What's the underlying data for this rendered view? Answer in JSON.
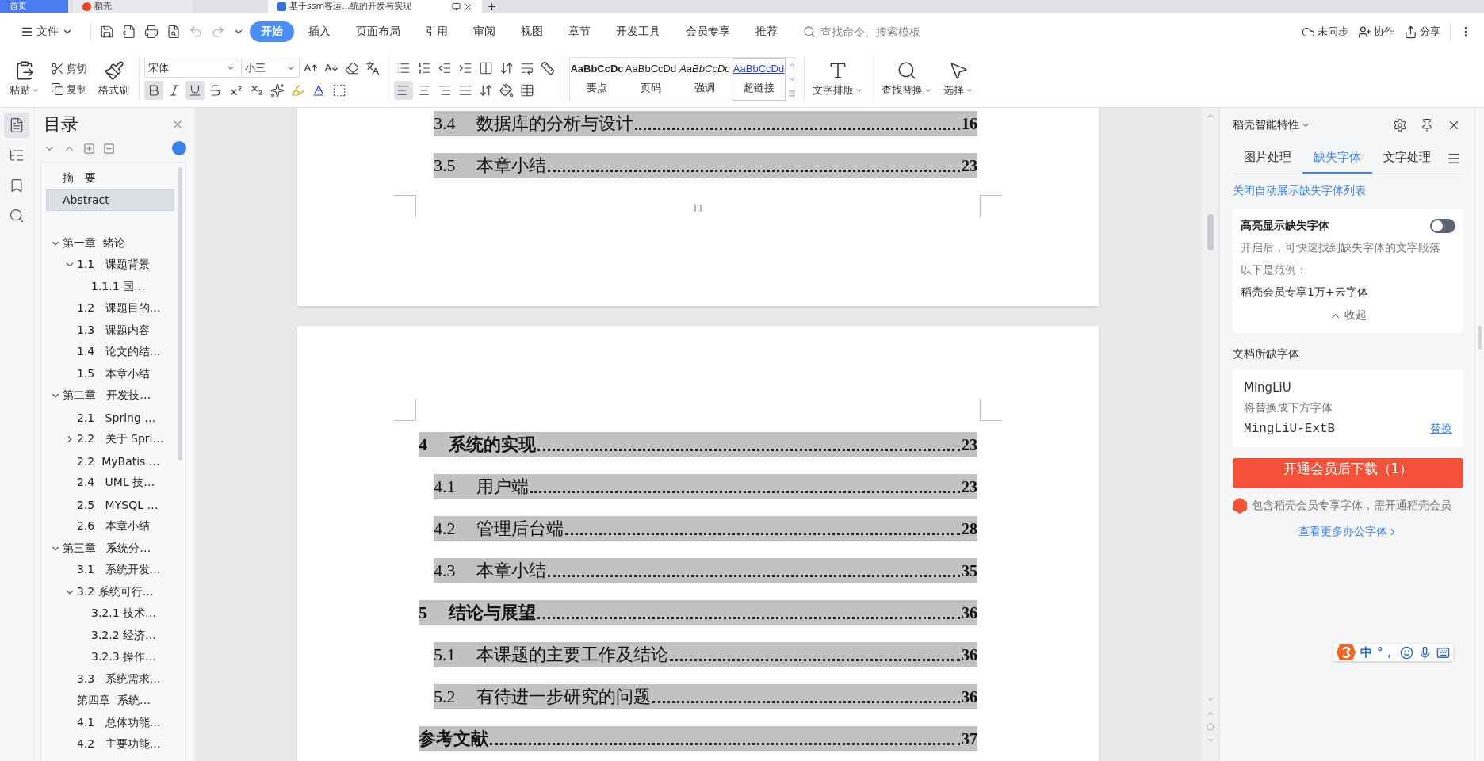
{
  "tabs": [
    {
      "label": "首页",
      "kind": "home",
      "selected": false
    },
    {
      "label": "稻壳",
      "kind": "docer",
      "selected": false
    },
    {
      "label": "基于ssm客运...统的开发与实现",
      "kind": "doc",
      "selected": true
    }
  ],
  "menu": {
    "file": "文件",
    "items": [
      {
        "label": "开始",
        "selected": true
      },
      {
        "label": "插入",
        "selected": false
      },
      {
        "label": "页面布局",
        "selected": false
      },
      {
        "label": "引用",
        "selected": false
      },
      {
        "label": "审阅",
        "selected": false
      },
      {
        "label": "视图",
        "selected": false
      },
      {
        "label": "章节",
        "selected": false
      },
      {
        "label": "开发工具",
        "selected": false
      },
      {
        "label": "会员专享",
        "selected": false
      },
      {
        "label": "推荐",
        "selected": false
      }
    ],
    "search": {
      "placeholder": "查找命令、搜索模板"
    },
    "actions": [
      {
        "kind": "sync",
        "label": "未同步"
      },
      {
        "kind": "collab",
        "label": "协作"
      },
      {
        "kind": "share",
        "label": "分享"
      }
    ]
  },
  "ribbon": {
    "paste": "粘贴",
    "cut": "剪切",
    "copy": "复制",
    "format_painter": "格式刷",
    "font": "宋体",
    "size": "小三",
    "format": [
      {
        "kind": "bold",
        "on": true
      },
      {
        "kind": "italic",
        "on": false
      },
      {
        "kind": "underline",
        "on": true
      }
    ],
    "align": [
      {
        "kind": "left",
        "on": true
      },
      {
        "kind": "center",
        "on": false
      },
      {
        "kind": "right",
        "on": false
      },
      {
        "kind": "justify",
        "on": false
      }
    ],
    "styles": [
      {
        "sample": "AaBbCcDc",
        "label": "要点",
        "kind": "bold",
        "selected": false
      },
      {
        "sample": "AaBbCcDd",
        "label": "页码",
        "kind": "plain",
        "selected": false
      },
      {
        "sample": "AaBbCcDc",
        "label": "强调",
        "kind": "italic",
        "selected": false
      },
      {
        "sample": "AaBbCcDd",
        "label": "超链接",
        "kind": "link",
        "selected": true
      }
    ],
    "layout": "文字排版",
    "find": "查找替换",
    "select": "选择"
  },
  "outline": {
    "title": "目录",
    "items": [
      {
        "label": "摘　要",
        "selected": false
      },
      {
        "label": "Abstract",
        "selected": true
      },
      {
        "label": "第一章  绪论",
        "selected": false,
        "expanded": true,
        "children": [
          {
            "label": "1.1   课题背景",
            "selected": false,
            "expanded": true,
            "children": [
              {
                "label": "1.1.1 国…",
                "selected": false
              }
            ]
          },
          {
            "label": "1.2   课题目的…",
            "selected": false
          },
          {
            "label": "1.3   课题内容",
            "selected": false
          },
          {
            "label": "1.4   论文的结…",
            "selected": false
          },
          {
            "label": "1.5   本章小结",
            "selected": false
          }
        ]
      },
      {
        "label": "第二章   开发技…",
        "selected": false,
        "expanded": true,
        "children": [
          {
            "label": "2.1   Spring …",
            "selected": false
          },
          {
            "label": "2.2   关于 Spri…",
            "selected": false,
            "expanded": false
          },
          {
            "label": "2.2  MyBatis …",
            "selected": false
          },
          {
            "label": "2.4   UML 技…",
            "selected": false
          },
          {
            "label": "2.5   MYSQL …",
            "selected": false
          },
          {
            "label": "2.6   本章小结",
            "selected": false
          }
        ]
      },
      {
        "label": "第三章   系统分…",
        "selected": false,
        "expanded": true,
        "children": [
          {
            "label": "3.1   系统开发…",
            "selected": false
          },
          {
            "label": "3.2 系统可行…",
            "selected": false,
            "expanded": true,
            "children": [
              {
                "label": "3.2.1 技术…",
                "selected": false
              },
              {
                "label": "3.2.2 经济…",
                "selected": false
              },
              {
                "label": "3.2.3 操作…",
                "selected": false
              }
            ]
          },
          {
            "label": "3.3   系统需求…",
            "selected": false
          },
          {
            "label": "第四章  系统…",
            "selected": false
          },
          {
            "label": "4.1   总体功能…",
            "selected": false
          },
          {
            "label": "4.2   主要功能…",
            "selected": false
          }
        ]
      }
    ]
  },
  "document": {
    "pages": [
      {
        "footer": "III",
        "entries": [
          {
            "kind": "section",
            "number": "3.4",
            "title": "数据库的分析与设计",
            "page": "16"
          },
          {
            "kind": "section",
            "number": "3.5",
            "title": "本章小结",
            "page": "23"
          }
        ]
      },
      {
        "entries": [
          {
            "kind": "chapter",
            "number": "4",
            "title": "系统的实现",
            "page": "23"
          },
          {
            "kind": "section",
            "number": "4.1",
            "title": "用户端",
            "page": "23"
          },
          {
            "kind": "section",
            "number": "4.2",
            "title": "管理后台端",
            "page": "28"
          },
          {
            "kind": "section",
            "number": "4.3",
            "title": "本章小结",
            "page": "35"
          },
          {
            "kind": "chapter",
            "number": "5",
            "title": "结论与展望",
            "page": "36"
          },
          {
            "kind": "section",
            "number": "5.1",
            "title": "本课题的主要工作及结论",
            "page": "36"
          },
          {
            "kind": "section",
            "number": "5.2",
            "title": "有待进一步研究的问题",
            "page": "36"
          },
          {
            "kind": "chapter",
            "title": "参考文献",
            "page": "37"
          }
        ]
      }
    ]
  },
  "panel": {
    "title": "稻壳智能特性",
    "tabs": [
      {
        "label": "图片处理",
        "selected": false
      },
      {
        "label": "缺失字体",
        "selected": true
      },
      {
        "label": "文字处理",
        "selected": false
      }
    ],
    "close_link": "关闭自动展示缺失字体列表",
    "highlight": {
      "label": "高亮显示缺失字体",
      "on": false,
      "description": "开启后，可快速找到缺失字体的文字段落",
      "example_label": "以下是范例：",
      "example": "稻壳会员专享1万+云字体",
      "collapse": "收起"
    },
    "missing_title": "文档所缺字体",
    "missing_font": {
      "name": "MingLiU",
      "hint": "将替换成下方字体",
      "replacement": "MingLiU-ExtB",
      "action": "替换"
    },
    "download": "开通会员后下载（1）",
    "note": "包含稻壳会员专享字体，需开通稻壳会员",
    "more": "查看更多办公字体"
  },
  "ime": {
    "mode": "中",
    "punct": "°，"
  }
}
